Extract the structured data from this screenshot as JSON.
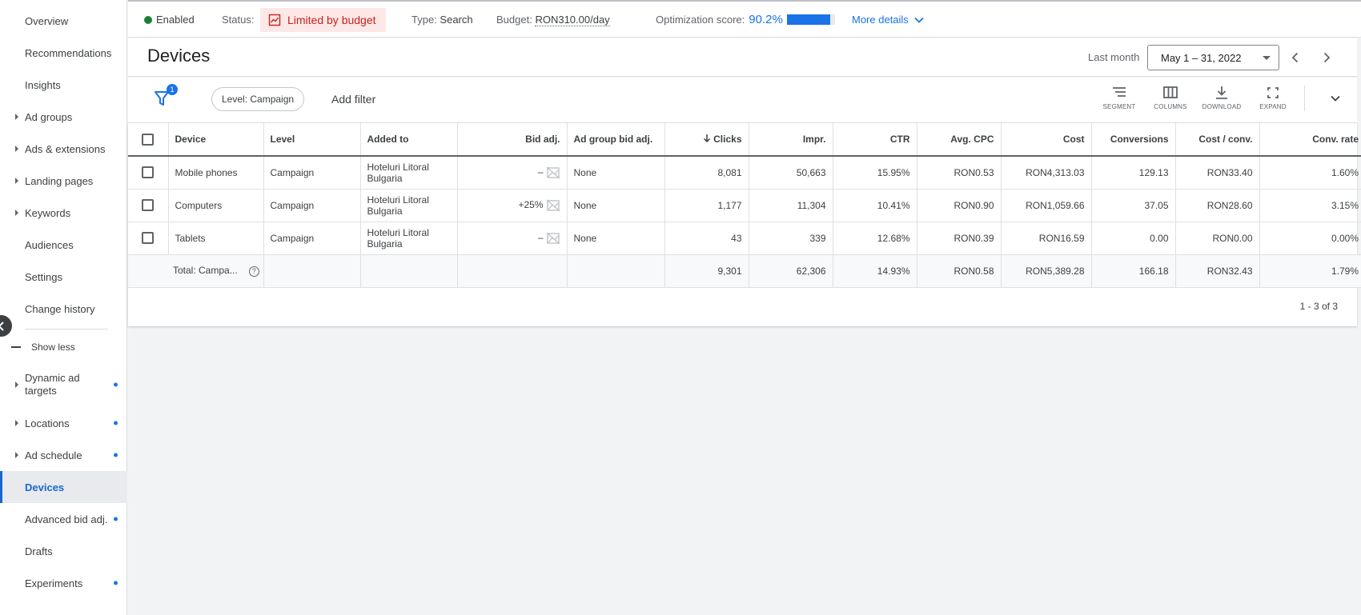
{
  "sidebar": {
    "items": [
      {
        "label": "Overview"
      },
      {
        "label": "Recommendations"
      },
      {
        "label": "Insights"
      },
      {
        "label": "Ad groups"
      },
      {
        "label": "Ads & extensions"
      },
      {
        "label": "Landing pages"
      },
      {
        "label": "Keywords"
      },
      {
        "label": "Audiences"
      },
      {
        "label": "Settings"
      },
      {
        "label": "Change history"
      }
    ],
    "show_less": "Show less",
    "more_items": [
      {
        "label": "Dynamic ad targets"
      },
      {
        "label": "Locations"
      },
      {
        "label": "Ad schedule"
      },
      {
        "label": "Devices"
      },
      {
        "label": "Advanced bid adj."
      },
      {
        "label": "Drafts"
      },
      {
        "label": "Experiments"
      }
    ],
    "active_item": "Devices",
    "accent_color": "#1967d2"
  },
  "status_bar": {
    "state": "Enabled",
    "status_label": "Status:",
    "status_value": "Limited by budget",
    "type_label": "Type:",
    "type_value": "Search",
    "budget_label": "Budget:",
    "budget_value": "RON310.00/day",
    "opt_label": "Optimization score:",
    "opt_value": "90.2%",
    "opt_fraction": 0.902,
    "more_details": "More details"
  },
  "header": {
    "title": "Devices",
    "range_label": "Last month",
    "date_range": "May 1 – 31, 2022"
  },
  "toolbar": {
    "filter_count": "1",
    "level_chip": "Level: Campaign",
    "add_filter": "Add filter",
    "segment": "SEGMENT",
    "columns": "COLUMNS",
    "download": "DOWNLOAD",
    "expand": "EXPAND"
  },
  "table": {
    "headers": {
      "device": "Device",
      "level": "Level",
      "added_to": "Added to",
      "bid_adj": "Bid adj.",
      "ad_group_bid_adj": "Ad group bid adj.",
      "clicks": "Clicks",
      "impr": "Impr.",
      "ctr": "CTR",
      "avg_cpc": "Avg. CPC",
      "cost": "Cost",
      "conversions": "Conversions",
      "cost_conv": "Cost / conv.",
      "conv_rate": "Conv. rate"
    },
    "rows": [
      {
        "device": "Mobile phones",
        "level": "Campaign",
        "added_to": "Hoteluri Litoral Bulgaria",
        "bid_adj": "–",
        "ad_group_bid_adj": "None",
        "clicks": "8,081",
        "impr": "50,663",
        "ctr": "15.95%",
        "avg_cpc": "RON0.53",
        "cost": "RON4,313.03",
        "conversions": "129.13",
        "cost_conv": "RON33.40",
        "conv_rate": "1.60%"
      },
      {
        "device": "Computers",
        "level": "Campaign",
        "added_to": "Hoteluri Litoral Bulgaria",
        "bid_adj": "+25%",
        "ad_group_bid_adj": "None",
        "clicks": "1,177",
        "impr": "11,304",
        "ctr": "10.41%",
        "avg_cpc": "RON0.90",
        "cost": "RON1,059.66",
        "conversions": "37.05",
        "cost_conv": "RON28.60",
        "conv_rate": "3.15%"
      },
      {
        "device": "Tablets",
        "level": "Campaign",
        "added_to": "Hoteluri Litoral Bulgaria",
        "bid_adj": "–",
        "ad_group_bid_adj": "None",
        "clicks": "43",
        "impr": "339",
        "ctr": "12.68%",
        "avg_cpc": "RON0.39",
        "cost": "RON16.59",
        "conversions": "0.00",
        "cost_conv": "RON0.00",
        "conv_rate": "0.00%"
      }
    ],
    "total": {
      "label": "Total: Campa...",
      "clicks": "9,301",
      "impr": "62,306",
      "ctr": "14.93%",
      "avg_cpc": "RON0.58",
      "cost": "RON5,389.28",
      "conversions": "166.18",
      "cost_conv": "RON32.43",
      "conv_rate": "1.79%"
    },
    "pagination": "1 - 3 of 3"
  }
}
